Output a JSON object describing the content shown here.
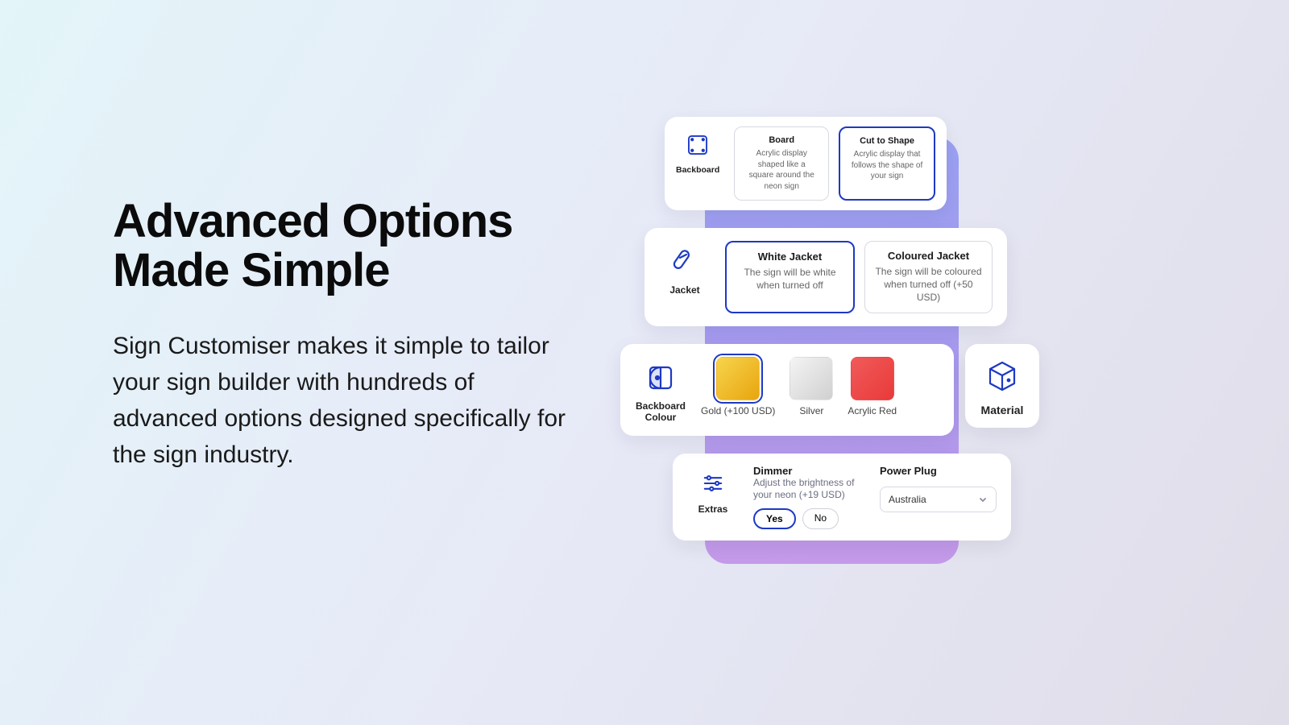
{
  "hero": {
    "title_line1": "Advanced Options",
    "title_line2": "Made Simple",
    "body": "Sign Customiser makes it simple to tailor your sign builder with hundreds of advanced options designed specifically for the sign industry."
  },
  "backboard": {
    "label": "Backboard",
    "options": [
      {
        "title": "Board",
        "desc": "Acrylic display shaped like a square around the neon sign",
        "selected": false
      },
      {
        "title": "Cut to Shape",
        "desc": "Acrylic display that follows the shape of your sign",
        "selected": true
      }
    ]
  },
  "jacket": {
    "label": "Jacket",
    "options": [
      {
        "title": "White Jacket",
        "desc": "The sign will be white when turned off",
        "selected": true
      },
      {
        "title": "Coloured Jacket",
        "desc": "The sign will be coloured when turned off (+50 USD)",
        "selected": false
      }
    ]
  },
  "backboard_colour": {
    "label_line1": "Backboard",
    "label_line2": "Colour",
    "swatches": [
      {
        "label": "Gold (+100 USD)",
        "color": "linear-gradient(135deg,#f7d44c 0%,#e8a50f 100%)",
        "selected": true
      },
      {
        "label": "Silver",
        "color": "linear-gradient(135deg,#f4f4f4 0%,#d0d0d0 100%)",
        "selected": false
      },
      {
        "label": "Acrylic Red",
        "color": "linear-gradient(135deg,#f15a5a 0%,#e93a3a 100%)",
        "selected": false
      }
    ]
  },
  "material": {
    "label": "Material"
  },
  "extras": {
    "label": "Extras",
    "dimmer": {
      "title": "Dimmer",
      "desc": "Adjust the brightness of your neon (+19 USD)",
      "yes": "Yes",
      "no": "No",
      "selected": "Yes"
    },
    "plug": {
      "title": "Power Plug",
      "selected": "Australia"
    }
  }
}
